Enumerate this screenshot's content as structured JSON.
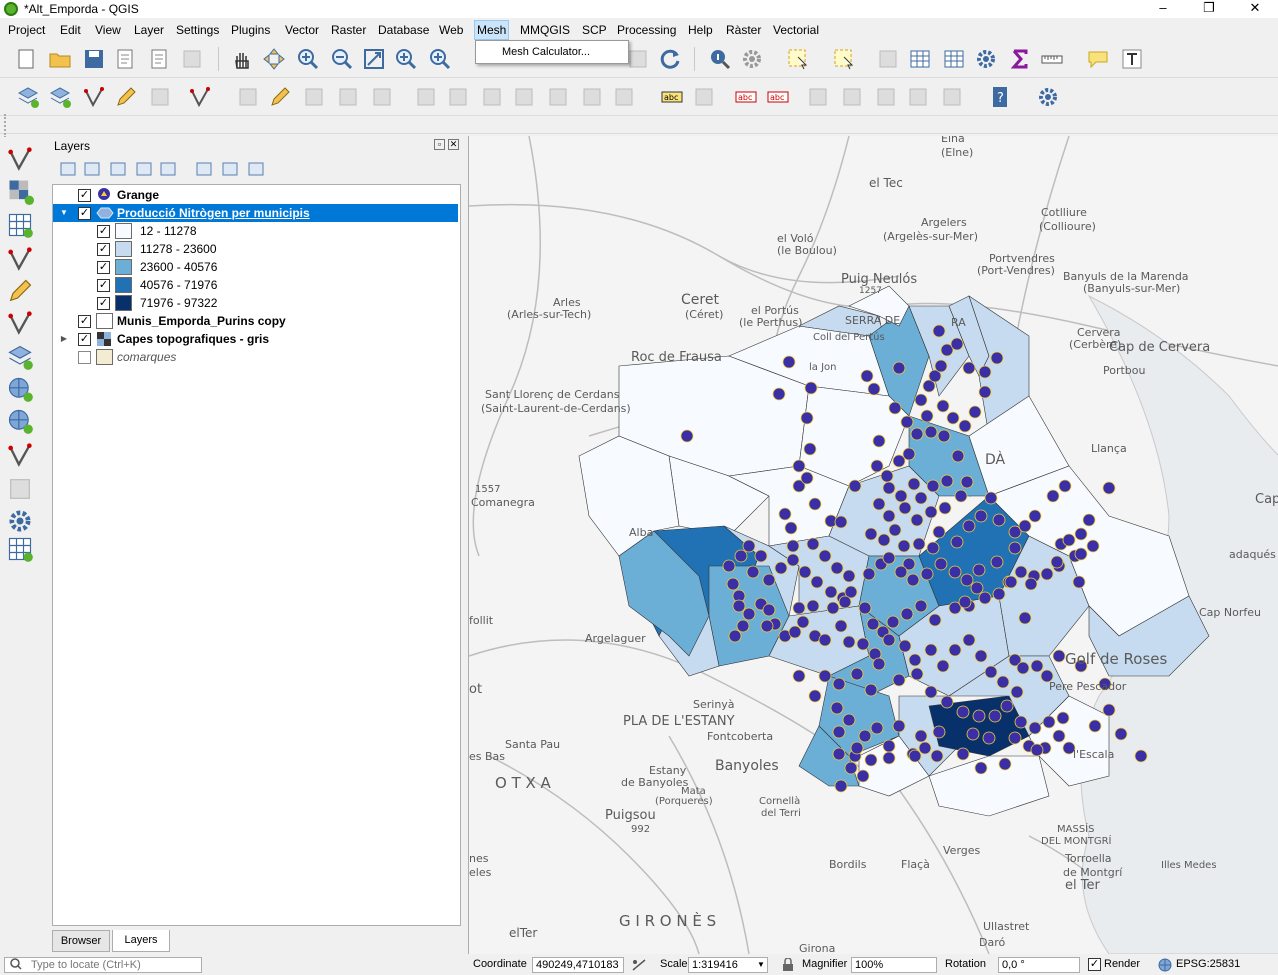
{
  "window": {
    "title": "*Alt_Emporda - QGIS",
    "minimize": "–",
    "restore": "❐",
    "close": "✕"
  },
  "menu": [
    {
      "label": "Project",
      "name": "menu-project"
    },
    {
      "label": "Edit",
      "name": "menu-edit"
    },
    {
      "label": "View",
      "name": "menu-view"
    },
    {
      "label": "Layer",
      "name": "menu-layer"
    },
    {
      "label": "Settings",
      "name": "menu-settings"
    },
    {
      "label": "Plugins",
      "name": "menu-plugins"
    },
    {
      "label": "Vector",
      "name": "menu-vector"
    },
    {
      "label": "Raster",
      "name": "menu-raster"
    },
    {
      "label": "Database",
      "name": "menu-database"
    },
    {
      "label": "Web",
      "name": "menu-web"
    },
    {
      "label": "Mesh",
      "name": "menu-mesh"
    },
    {
      "label": "MMQGIS",
      "name": "menu-mmqgis"
    },
    {
      "label": "SCP",
      "name": "menu-scp"
    },
    {
      "label": "Processing",
      "name": "menu-processing"
    },
    {
      "label": "Help",
      "name": "menu-help"
    },
    {
      "label": "Ràster",
      "name": "menu-raster-ca"
    },
    {
      "label": "Vectorial",
      "name": "menu-vectorial"
    }
  ],
  "mesh_dropdown": {
    "item": "Mesh Calculator..."
  },
  "layers_panel": {
    "title": "Layers",
    "layers": [
      {
        "label": "Grange",
        "checked": true
      },
      {
        "label": "Producció Nitrògen per municipis",
        "checked": true,
        "selected": true
      },
      {
        "label": "Munis_Emporda_Purins copy",
        "checked": true
      },
      {
        "label": "Capes topografiques - gris",
        "checked": true
      },
      {
        "label": "comarques",
        "checked": false
      }
    ],
    "legend": [
      {
        "label": "12 - 11278",
        "color": "#f7fbff"
      },
      {
        "label": "11278 - 23600",
        "color": "#c6dbef"
      },
      {
        "label": "23600 - 40576",
        "color": "#6baed6"
      },
      {
        "label": "40576 - 71976",
        "color": "#2171b5"
      },
      {
        "label": "71976 - 97322",
        "color": "#08306b"
      }
    ],
    "tabs": [
      "Browser",
      "Layers"
    ]
  },
  "map_labels": {
    "elna": "Elna",
    "elne": "(Elne)",
    "eltec": "el Tec",
    "argeles": "Argelers",
    "argeles_fr": "(Argelès-sur-Mer)",
    "elvolo": "el Voló",
    "elvolo_fr": "(le Boulou)",
    "cotlliure": "Cotlliure",
    "collioure": "(Collioure)",
    "portvendres": "Portvendres",
    "portvendres_fr": "(Port-Vendres)",
    "puig": "Puig Neulós",
    "puig_h": "1257",
    "banyuls": "Banyuls de la Marenda",
    "banyuls_fr": "(Banyuls-sur-Mer)",
    "ceret": "Ceret",
    "ceret_fr": "(Céret)",
    "arles": "Arles",
    "arles_fr": "(Arles-sur-Tech)",
    "pertus": "el Portús",
    "pertus_fr": "(le Perthus)",
    "serra": "SERRA  DE",
    "serra2": "RA",
    "coll": "Coll del Pertús",
    "cerbere": "Cervera",
    "cerbere_fr": "(Cerbère)",
    "capcervera": "Cap de Cervera",
    "portbou": "Portbou",
    "rocfrausa": "Roc de Frausa",
    "lajon": "la Jon",
    "stlorenc": "Sant Llorenç de Cerdans",
    "stlorenc_fr": "(Saint-Laurent-de-Cerdans)",
    "comanegra": "Comanegra",
    "comanegra_h": "1557",
    "alba": "Alba",
    "llança": "Llança",
    "da": "DÀ",
    "cap": "Cap",
    "cadaques": "adaqués",
    "capnorfeu": "Cap Norfeu",
    "golf": "Golf de Roses",
    "perepescador": "Pere Pescador",
    "follit": "follit",
    "argelaguer": "Argelaguer",
    "ot": "ot",
    "serinya": "Serinyà",
    "pladelestany": "PLA  DE  L'ESTANY",
    "fontcoberta": "Fontcoberta",
    "santapau": "Santa Pau",
    "esbas": "es Bas",
    "estany": "Estany",
    "debanyoles": "de Banyoles",
    "banyoles": "Banyoles",
    "matapro": "Mata",
    "porqueres": "(Porqueres)",
    "otxa": "O T X A",
    "puigsou": "Puigsou",
    "puigsou_h": "992",
    "comella": "Cornellà",
    "delter": "del Terri",
    "lescala": "l'Escala",
    "massis": "MASSÍS",
    "montgri": "DEL MONTGRÍ",
    "verges": "Verges",
    "torroella": "Torroella",
    "demontgri": "de Montgrí",
    "illesmedes": "Illes Medes",
    "elter": "el Ter",
    "bordils": "Bordils",
    "flaça": "Flaçà",
    "girones": "G I R O N È S",
    "ullastret": "Ullastret",
    "nes": "nes",
    "eles": "eles",
    "elter2": "elTer",
    "dare": "Daró",
    "girona": "Girona"
  },
  "status": {
    "locate_placeholder": "Type to locate (Ctrl+K)",
    "coordinate_label": "Coordinate",
    "coordinate": "490249,4710183",
    "scale_label": "Scale",
    "scale": "1:319416",
    "magnifier_label": "Magnifier",
    "magnifier": "100%",
    "rotation_label": "Rotation",
    "rotation": "0,0 °",
    "render_label": "Render",
    "crs": "EPSG:25831"
  }
}
